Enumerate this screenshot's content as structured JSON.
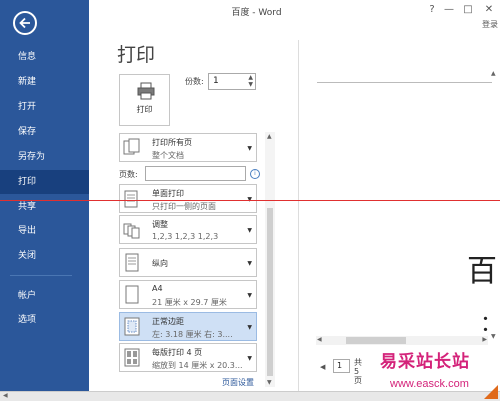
{
  "window": {
    "title": "百度 - Word",
    "help": "?",
    "minimize": "—",
    "restore": "□",
    "close": "✕",
    "login": "登录"
  },
  "sidebar": {
    "items": [
      {
        "label": "信息"
      },
      {
        "label": "新建"
      },
      {
        "label": "打开"
      },
      {
        "label": "保存"
      },
      {
        "label": "另存为"
      },
      {
        "label": "打印"
      },
      {
        "label": "共享"
      },
      {
        "label": "导出"
      },
      {
        "label": "关闭"
      },
      {
        "label": "帐户"
      },
      {
        "label": "选项"
      }
    ],
    "active": "打印",
    "bg_color": "#2b579a"
  },
  "print": {
    "title": "打印",
    "button_label": "打印",
    "copies_label": "份数:",
    "copies_value": "1",
    "pages_label": "页数:",
    "pages_value": "",
    "page_setup_link": "页面设置",
    "settings": [
      {
        "line1": "打印所有页",
        "line2": "整个文档"
      },
      {
        "line1": "单面打印",
        "line2": "只打印一侧的页面"
      },
      {
        "line1": "调整",
        "line2": "1,2,3    1,2,3    1,2,3"
      },
      {
        "line1": "纵向",
        "line2": ""
      },
      {
        "line1": "A4",
        "line2": "21 厘米 x 29.7 厘米"
      },
      {
        "line1": "正常边距",
        "line2": "左: 3.18 厘米    右: 3...."
      },
      {
        "line1": "每版打印 4 页",
        "line2": "缩放到 14 厘米 x 20.3..."
      }
    ]
  },
  "preview": {
    "glyph": "百",
    "glyph2": "：",
    "page_current": "1",
    "page_total": "共 5 页"
  },
  "watermark": {
    "main": "易采站长站",
    "sub": "www.easck.com",
    "color": "#d4237a"
  }
}
